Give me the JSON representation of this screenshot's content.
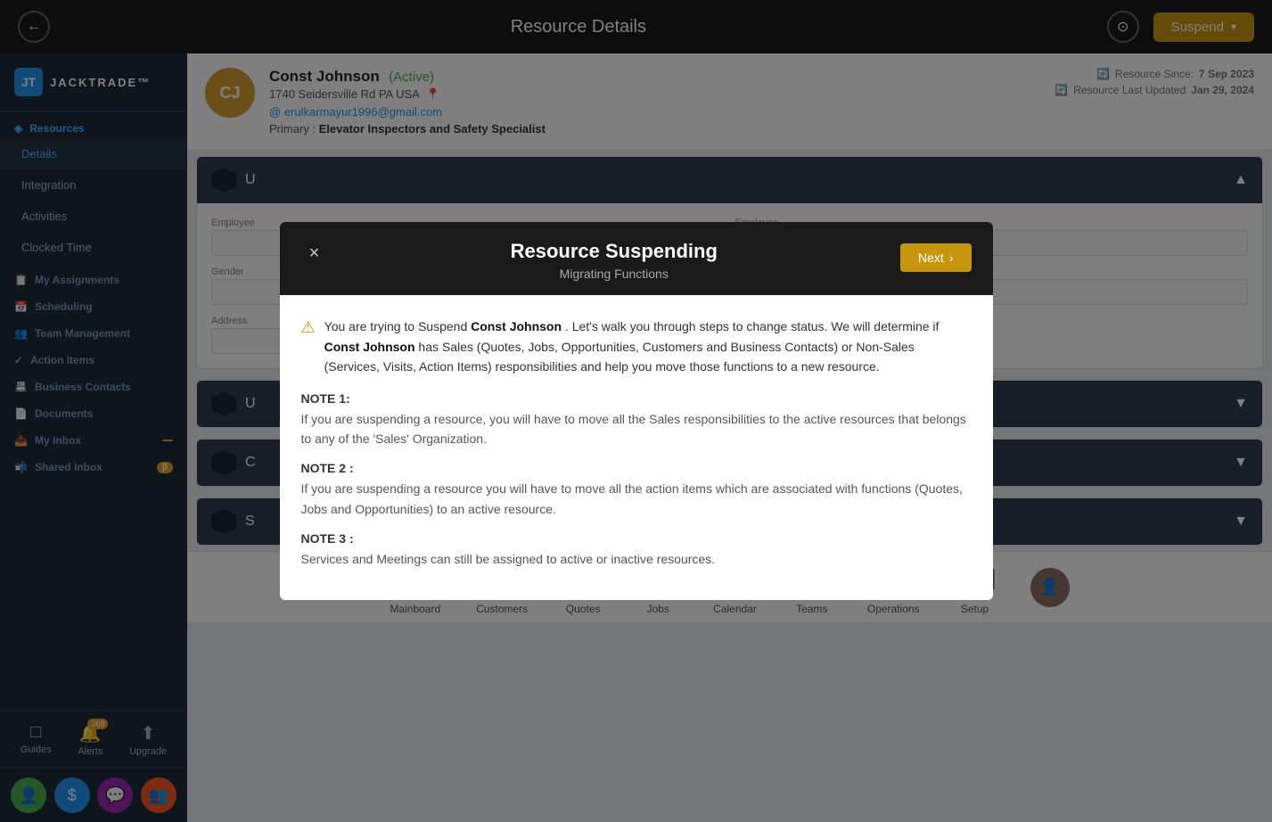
{
  "header": {
    "title": "Resource Details",
    "back_label": "←",
    "compass_label": "⊙",
    "suspend_label": "Suspend",
    "suspend_chevron": "▾"
  },
  "sidebar": {
    "logo_icon": "JT",
    "logo_text": "JACKTRADE™",
    "sections": [
      {
        "label": "Resources",
        "active": true,
        "items": [
          {
            "label": "Details",
            "active": true,
            "icon": ""
          },
          {
            "label": "Integration",
            "active": false,
            "icon": ""
          },
          {
            "label": "Activities",
            "active": false,
            "icon": ""
          },
          {
            "label": "Clocked Time",
            "active": false,
            "icon": ""
          }
        ]
      },
      {
        "label": "My Assignments",
        "active": false,
        "icon": "📋",
        "items": []
      },
      {
        "label": "Scheduling",
        "active": false,
        "icon": "📅",
        "items": []
      },
      {
        "label": "Team Management",
        "active": false,
        "icon": "👥",
        "items": []
      },
      {
        "label": "Action Items",
        "active": false,
        "icon": "✓",
        "items": []
      },
      {
        "label": "Business Contacts",
        "active": false,
        "icon": "📇",
        "items": []
      },
      {
        "label": "Documents",
        "active": false,
        "icon": "📄",
        "items": []
      },
      {
        "label": "My Inbox",
        "active": false,
        "icon": "📥",
        "badge": ""
      },
      {
        "label": "Shared Inbox",
        "active": false,
        "icon": "📬",
        "badge": "β"
      }
    ],
    "nav_items": [
      {
        "label": "Guides",
        "icon": "□"
      },
      {
        "label": "Alerts",
        "icon": "🔔",
        "badge": "268"
      },
      {
        "label": "Upgrade",
        "icon": "⬆"
      }
    ],
    "bottom_icons": [
      {
        "label": "person",
        "color": "#4caf50"
      },
      {
        "label": "dollar",
        "color": "#2196F3"
      },
      {
        "label": "chat",
        "color": "#9c27b0"
      },
      {
        "label": "group",
        "color": "#ff5722"
      }
    ]
  },
  "resource": {
    "initials": "CJ",
    "name": "Const Johnson",
    "status": "(Active)",
    "address": "1740 Seidersville Rd PA USA",
    "email": "erulkarmayur1996@gmail.com",
    "primary_label": "Primary :",
    "primary_value": "Elevator Inspectors and Safety Specialist",
    "since_label": "Resource Since:",
    "since_value": "7 Sep 2023",
    "updated_label": "Resource Last Updated",
    "updated_value": "Jan 29, 2024"
  },
  "sections": [
    {
      "id": "U",
      "label": "U...",
      "collapsed": false
    },
    {
      "id": "U2",
      "label": "U...",
      "collapsed": true
    },
    {
      "id": "C",
      "label": "C...",
      "collapsed": true
    },
    {
      "id": "S",
      "label": "S...",
      "collapsed": true
    }
  ],
  "bottom_nav": {
    "items": [
      {
        "label": "Mainboard",
        "color": "#d4a030",
        "icon": "⌂"
      },
      {
        "label": "Customers",
        "color": "#4caf50",
        "icon": "👤"
      },
      {
        "label": "Quotes",
        "color": "#7b1fa2",
        "icon": "💬"
      },
      {
        "label": "Jobs",
        "color": "#c62828",
        "icon": "🔧"
      },
      {
        "label": "Calendar",
        "color": "#ef6c00",
        "icon": "📅"
      },
      {
        "label": "Teams",
        "color": "#00838f",
        "icon": "👥"
      },
      {
        "label": "Operations",
        "color": "#b71c1c",
        "icon": "⚙"
      },
      {
        "label": "Setup",
        "color": "#546e7a",
        "icon": "⚙"
      }
    ]
  },
  "modal": {
    "title": "Resource Suspending",
    "subtitle": "Migrating Functions",
    "close_label": "×",
    "next_label": "Next",
    "next_icon": "›",
    "warning_text_pre": "You are trying to Suspend ",
    "warning_name1": "Const Johnson",
    "warning_text_mid": " . Let's walk you through steps to change status. We will determine if ",
    "warning_name2": "Const Johnson",
    "warning_text_post": " has Sales (Quotes, Jobs, Opportunities, Customers and Business Contacts) or Non-Sales (Services, Visits, Action Items) responsibilities and help you move those functions to a new resource.",
    "notes": [
      {
        "title": "NOTE 1:",
        "text": "If you are suspending a resource, you will have to move all the Sales responsibilities to the active resources that belongs to any of the 'Sales' Organization."
      },
      {
        "title": "NOTE 2 :",
        "text": "If you are suspending a resource you will have to move all the action items which are associated with functions (Quotes, Jobs and Opportunities) to an active resource."
      },
      {
        "title": "NOTE 3 :",
        "text": "Services and Meetings can still be assigned to active or inactive resources."
      }
    ]
  }
}
